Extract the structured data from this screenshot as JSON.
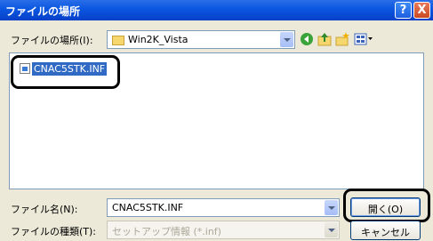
{
  "title": "ファイルの場所",
  "title_buttons": {
    "help": "?",
    "close": "X"
  },
  "location": {
    "label": "ファイルの場所(I):",
    "value": "Win2K_Vista"
  },
  "toolbar": [
    "back-icon",
    "up-folder-icon",
    "new-folder-icon",
    "view-menu-icon"
  ],
  "files": [
    {
      "name": "CNAC5STK.INF",
      "selected": true
    }
  ],
  "filename": {
    "label": "ファイル名(N):",
    "value": "CNAC5STK.INF"
  },
  "filetype": {
    "label": "ファイルの種類(T):",
    "value": "セットアップ情報 (*.inf)"
  },
  "buttons": {
    "open": "開く(O)",
    "cancel": "キャンセル"
  },
  "colors": {
    "title_bar": "#0a56e0",
    "selection": "#316ac5",
    "dialog_bg": "#ECE9D8",
    "callout": "#000000"
  }
}
